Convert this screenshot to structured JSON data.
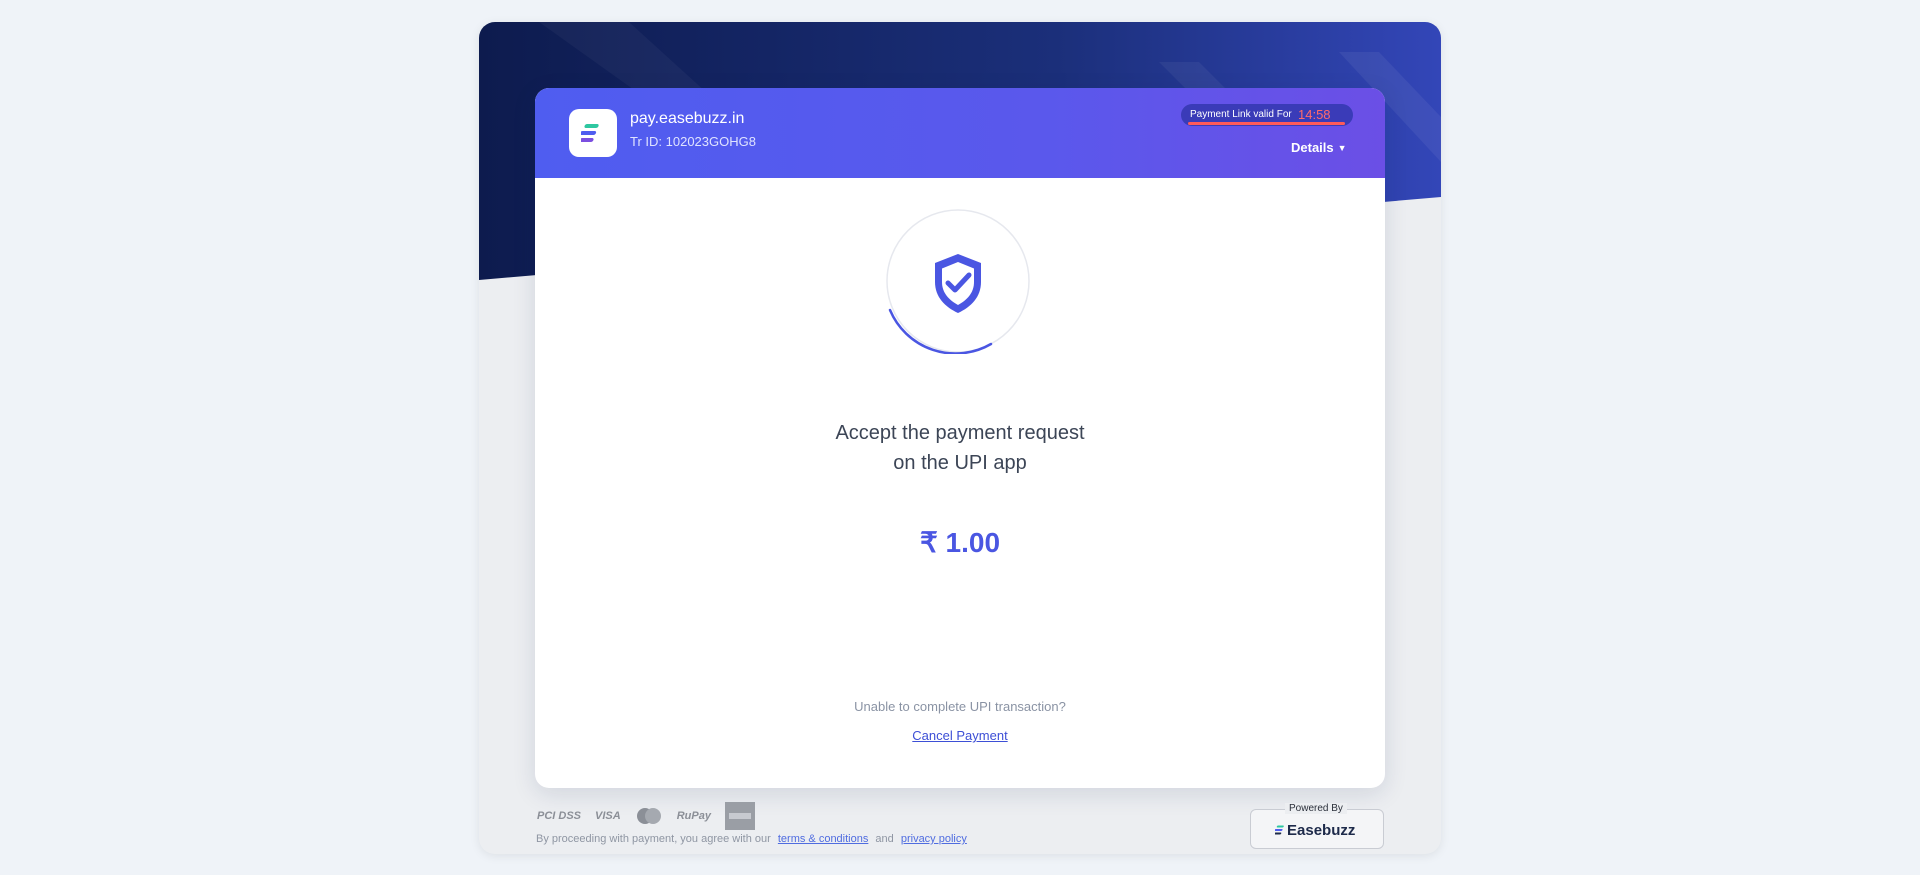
{
  "header": {
    "merchant": "pay.easebuzz.in",
    "tr_id": "Tr ID: 102023GOHG8",
    "timer_label": "Payment Link valid For",
    "timer_value": "14:58",
    "details_label": "Details"
  },
  "main": {
    "status_icon": "shield-check-icon",
    "message_line1": "Accept the payment request",
    "message_line2": "on the UPI app",
    "amount": "₹ 1.00",
    "unable_text": "Unable to complete UPI transaction?",
    "cancel_label": "Cancel Payment"
  },
  "footer": {
    "card_logos": [
      "PCI DSS",
      "VISA",
      "mastercard-icon",
      "RuPay",
      "amex-icon"
    ],
    "terms_prefix": "By proceeding with payment, you agree with our",
    "terms_link": "terms & conditions",
    "and_text": "and",
    "privacy_link": "privacy policy",
    "powered_label": "Powered By",
    "powered_brand": "Easebuzz"
  },
  "colors": {
    "header_bg": "#4f5df0",
    "accent": "#4a56e2",
    "timer_text": "#ff6b6b",
    "dark_navy": "#0e1f55"
  }
}
